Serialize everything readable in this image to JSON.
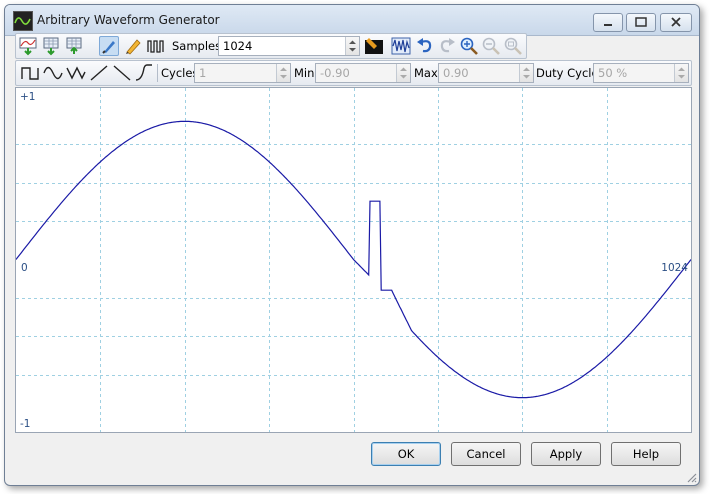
{
  "window": {
    "title": "Arbitrary Waveform Generator"
  },
  "toolbar": {
    "samples_label": "Samples",
    "samples_value": "1024"
  },
  "shapebar": {
    "cycles_label": "Cycles",
    "cycles_value": "1",
    "min_label": "Min",
    "min_value": "-0.90",
    "max_label": "Max",
    "max_value": "0.90",
    "duty_label": "Duty Cycle",
    "duty_value": "50 %"
  },
  "plot": {
    "y_top_label": "+1",
    "y_bottom_label": "-1",
    "x_start_label": "0",
    "x_end_label": "1024"
  },
  "buttons": {
    "ok": "OK",
    "cancel": "Cancel",
    "apply": "Apply",
    "help": "Help"
  },
  "colors": {
    "waveform": "#1a1aa6",
    "grid": "#9fd0e2",
    "accent": "#7ea9d8"
  },
  "chart_data": {
    "type": "line",
    "xlim": [
      0,
      1024
    ],
    "ylim": [
      -1,
      1
    ],
    "samples": 1024,
    "series": [
      {
        "x": [
          0,
          256,
          512,
          535,
          537,
          552,
          554,
          570,
          572,
          768,
          1024
        ],
        "y": [
          0,
          0.9,
          0,
          -0.1,
          0.38,
          0.38,
          -0.2,
          -0.2,
          -0.22,
          -0.9,
          0
        ]
      }
    ]
  }
}
